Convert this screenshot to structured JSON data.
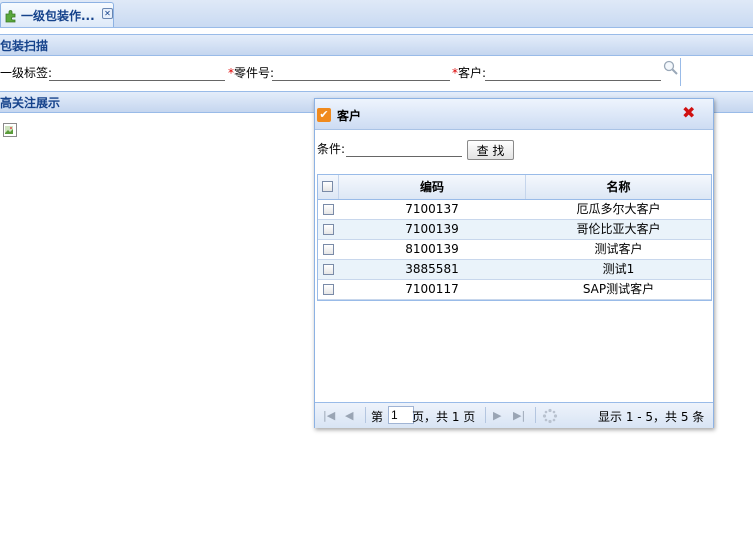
{
  "tab": {
    "label": "一级包装作...",
    "close": "✕"
  },
  "sections": {
    "scan_title": "包装扫描",
    "display_title": "高关注展示"
  },
  "form": {
    "label1": "一级标签:",
    "label2": "零件号:",
    "label3": "客户:",
    "required_mark": "*"
  },
  "dialog": {
    "title": "客户",
    "condition_label": "条件:",
    "find_button": "查 找",
    "columns": [
      "编码",
      "名称"
    ],
    "rows": [
      {
        "code": "7100137",
        "name": "厄瓜多尔大客户"
      },
      {
        "code": "7100139",
        "name": "哥伦比亚大客户"
      },
      {
        "code": "8100139",
        "name": "测试客户"
      },
      {
        "code": "3885581",
        "name": "测试1"
      },
      {
        "code": "7100117",
        "name": "SAP测试客户"
      }
    ],
    "pager": {
      "page_prefix": "第",
      "page_value": "1",
      "page_suffix": "页，共 1 页",
      "display": "显示 1 - 5，共 5 条"
    }
  }
}
